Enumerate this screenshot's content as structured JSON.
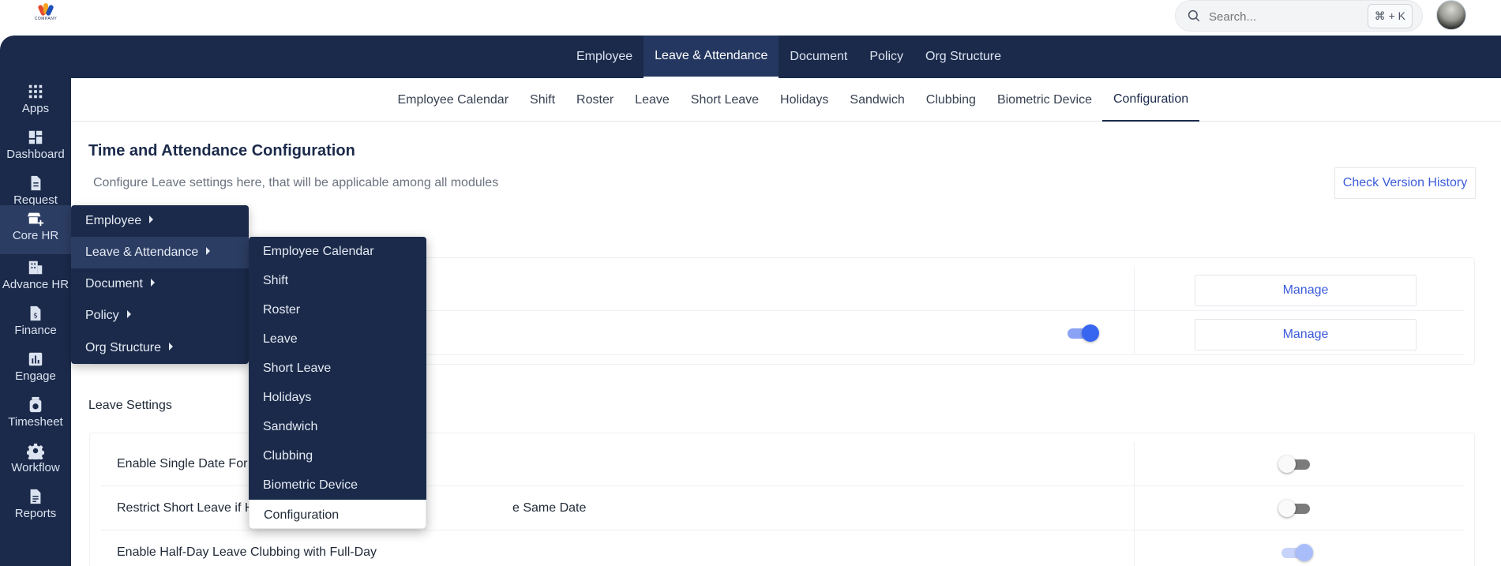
{
  "logo": {
    "text": "COMPANY"
  },
  "search": {
    "placeholder": "Search...",
    "shortcut": "⌘ + K"
  },
  "top_tabs": [
    "Employee",
    "Leave & Attendance",
    "Document",
    "Policy",
    "Org Structure"
  ],
  "active_top_tab": "Leave & Attendance",
  "sidebar": {
    "items": [
      {
        "label": "Apps",
        "icon": "apps-grid-icon"
      },
      {
        "label": "Dashboard",
        "icon": "dashboard-icon"
      },
      {
        "label": "Request",
        "icon": "document-icon"
      },
      {
        "label": "Core HR",
        "icon": "store-add-icon"
      },
      {
        "label": "Advance HR",
        "icon": "building-icon"
      },
      {
        "label": "Finance",
        "icon": "money-file-icon"
      },
      {
        "label": "Engage",
        "icon": "bar-chart-icon"
      },
      {
        "label": "Timesheet",
        "icon": "timer-icon"
      },
      {
        "label": "Workflow",
        "icon": "gear-icon"
      },
      {
        "label": "Reports",
        "icon": "report-icon"
      }
    ],
    "active": "Core HR"
  },
  "sub_tabs": [
    "Employee Calendar",
    "Shift",
    "Roster",
    "Leave",
    "Short Leave",
    "Holidays",
    "Sandwich",
    "Clubbing",
    "Biometric Device",
    "Configuration"
  ],
  "active_sub_tab": "Configuration",
  "page": {
    "title": "Time and Attendance Configuration",
    "subtitle": "Configure Leave settings here, that will be applicable among all modules",
    "version_button": "Check Version History"
  },
  "top_card": {
    "rows": [
      {
        "manage_label": "Manage",
        "toggle": null
      },
      {
        "manage_label": "Manage",
        "toggle": "on"
      }
    ]
  },
  "leave_settings": {
    "label": "Leave Settings",
    "rows": [
      {
        "label": "Enable Single Date For",
        "toggle": "off"
      },
      {
        "label_start": "Restrict Short Leave if H",
        "label_end": "e Same Date",
        "toggle": "off"
      },
      {
        "label": "Enable Half-Day Leave Clubbing with Full-Day",
        "toggle": "on-disabled"
      }
    ]
  },
  "menu_level1": {
    "items": [
      "Employee",
      "Leave & Attendance",
      "Document",
      "Policy",
      "Org Structure"
    ],
    "active": "Leave & Attendance"
  },
  "menu_level2": {
    "items": [
      "Employee Calendar",
      "Shift",
      "Roster",
      "Leave",
      "Short Leave",
      "Holidays",
      "Sandwich",
      "Clubbing",
      "Biometric Device",
      "Configuration"
    ],
    "selected": "Configuration"
  },
  "colors": {
    "navy": "#1b2a4a",
    "accent": "#3b5bdb",
    "toggle_on": "#3866f0"
  }
}
